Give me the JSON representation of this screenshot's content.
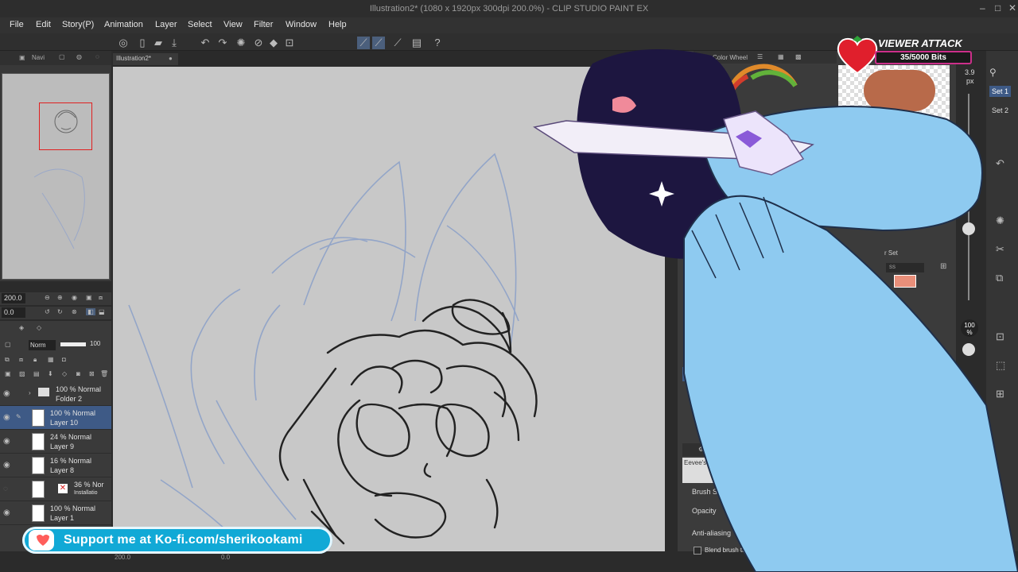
{
  "window": {
    "title": "Illustration2* (1080 x 1920px 300dpi 200.0%)  - CLIP STUDIO PAINT EX"
  },
  "menu": [
    "File",
    "Edit",
    "Story(P)",
    "Animation",
    "Layer",
    "Select",
    "View",
    "Filter",
    "Window",
    "Help"
  ],
  "navigator": {
    "tab_label": "Navi",
    "zoom_value": "200.0",
    "rotation_value": "0.0"
  },
  "document_tab": "Illustration2*",
  "layer_toolbar": {
    "blend_mode": "Norm",
    "opacity": "100"
  },
  "layers": [
    {
      "line1": "100 % Normal",
      "line2": "Folder 2",
      "type": "folder",
      "selected": false
    },
    {
      "line1": "100 % Normal",
      "line2": "Layer 10",
      "type": "raster",
      "selected": true
    },
    {
      "line1": "24 % Normal",
      "line2": "Layer 9",
      "type": "raster",
      "selected": false
    },
    {
      "line1": "16 % Normal",
      "line2": "Layer 8",
      "type": "raster",
      "selected": false
    },
    {
      "line1": "36 % Nor",
      "line2": "Installatio",
      "type": "raster",
      "selected": false
    },
    {
      "line1": "100 % Normal",
      "line2": "Layer 1",
      "type": "raster",
      "selected": false
    }
  ],
  "color_panel": {
    "tab_label": "Color Wheel"
  },
  "brush_size_indicator": {
    "value": "3.9",
    "unit": "px"
  },
  "opacity_indicator": {
    "value": "100",
    "unit": "%"
  },
  "sets": [
    "Set 1",
    "Set 2"
  ],
  "subtool_set_label": "r Set",
  "subtool_search": "ss",
  "tool_property": {
    "tab_label": "Tool Property",
    "brush_name": "Eevee's Soft Line",
    "properties": [
      "Brush Size",
      "Opacity",
      "Anti-aliasing"
    ],
    "checkbox_label": "Blend brush tips with Darken"
  },
  "bottom_status": {
    "zoom": "200.0",
    "rotation": "0.0"
  },
  "stream_overlay": {
    "viewer_attack_title": "VIEWER ATTACK",
    "bits_progress": "35/5000 Bits",
    "bits_fraction": 0.007,
    "kofi_text": "Support me at Ko-fi.com/sherikookami"
  },
  "colors": {
    "accent_blue": "#3e5a86",
    "kofi_blue": "#11a9d6",
    "bits_border": "#cc2f8a",
    "sleeve": "#8ecaf0",
    "paw": "#1d1640"
  }
}
